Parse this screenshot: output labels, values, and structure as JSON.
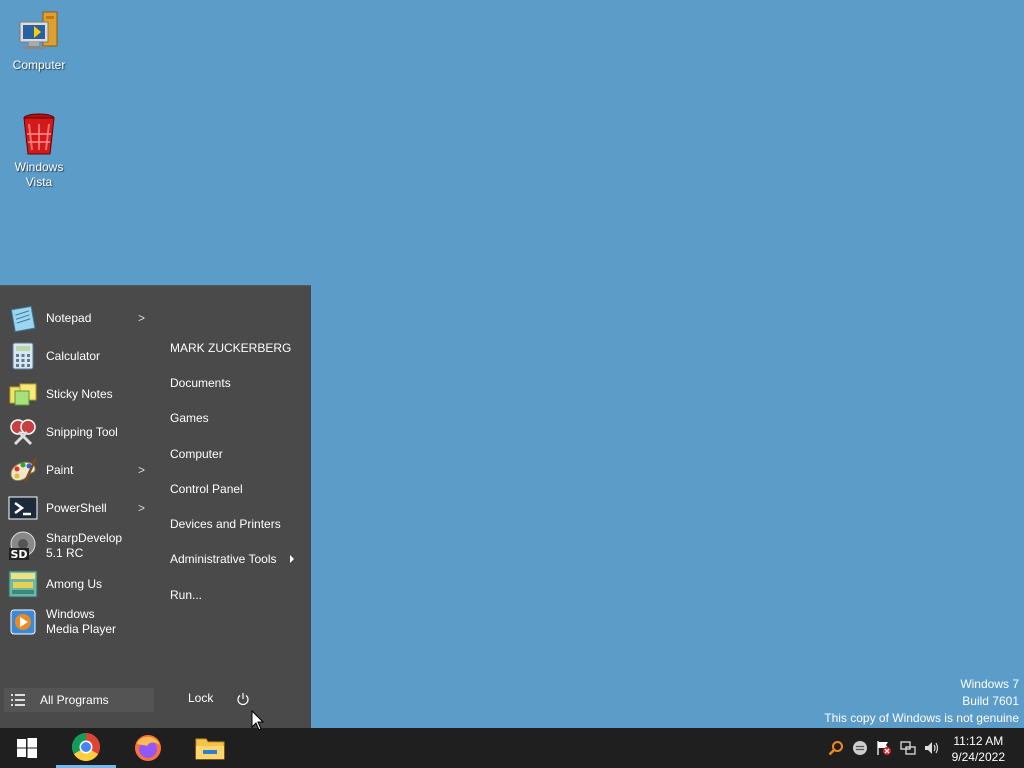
{
  "desktop": {
    "icons": [
      {
        "label": "Computer",
        "icon": "computer-icon"
      },
      {
        "label": "Windows Vista",
        "icon": "recycle-bin-icon"
      }
    ]
  },
  "start_menu": {
    "programs": [
      {
        "label": "Notepad",
        "icon": "notepad-icon",
        "submenu": true
      },
      {
        "label": "Calculator",
        "icon": "calculator-icon",
        "submenu": false
      },
      {
        "label": "Sticky Notes",
        "icon": "sticky-notes-icon",
        "submenu": false
      },
      {
        "label": "Snipping Tool",
        "icon": "snipping-tool-icon",
        "submenu": false
      },
      {
        "label": "Paint",
        "icon": "paint-icon",
        "submenu": true
      },
      {
        "label": "PowerShell",
        "icon": "powershell-icon",
        "submenu": true
      },
      {
        "label": "SharpDevelop 5.1 RC",
        "icon": "sharpdevelop-icon",
        "submenu": false
      },
      {
        "label": "Among Us",
        "icon": "among-us-icon",
        "submenu": false
      },
      {
        "label": "Windows Media Player",
        "icon": "media-player-icon",
        "submenu": false
      }
    ],
    "arrow": ">",
    "places": [
      {
        "label": "MARK ZUCKERBERG"
      },
      {
        "label": "Documents"
      },
      {
        "label": "Games"
      },
      {
        "label": "Computer"
      },
      {
        "label": "Control Panel"
      },
      {
        "label": "Devices and Printers"
      },
      {
        "label": "Administrative Tools",
        "submenu": true
      },
      {
        "label": "Run..."
      }
    ],
    "all_programs": "All Programs",
    "lock": "Lock",
    "power_icon": "power-icon"
  },
  "taskbar": {
    "apps": [
      {
        "name": "start-button",
        "icon": "windows-logo-icon"
      },
      {
        "name": "chrome",
        "icon": "chrome-icon",
        "active": true
      },
      {
        "name": "firefox",
        "icon": "firefox-icon"
      },
      {
        "name": "file-explorer",
        "icon": "folder-icon"
      }
    ],
    "tray_icons": [
      "search-icon",
      "chat-icon",
      "action-center-flag-icon",
      "network-icon",
      "volume-icon"
    ],
    "time": "11:12 AM",
    "date": "9/24/2022"
  },
  "watermark": {
    "line1": "Windows 7",
    "line2": "Build 7601",
    "line3": "This copy of Windows is not genuine"
  },
  "colors": {
    "desktop": "#5b9cc9",
    "start_menu": "#4a4a4a",
    "taskbar": "#1f1f1f",
    "active_indicator": "#76b9ed"
  }
}
